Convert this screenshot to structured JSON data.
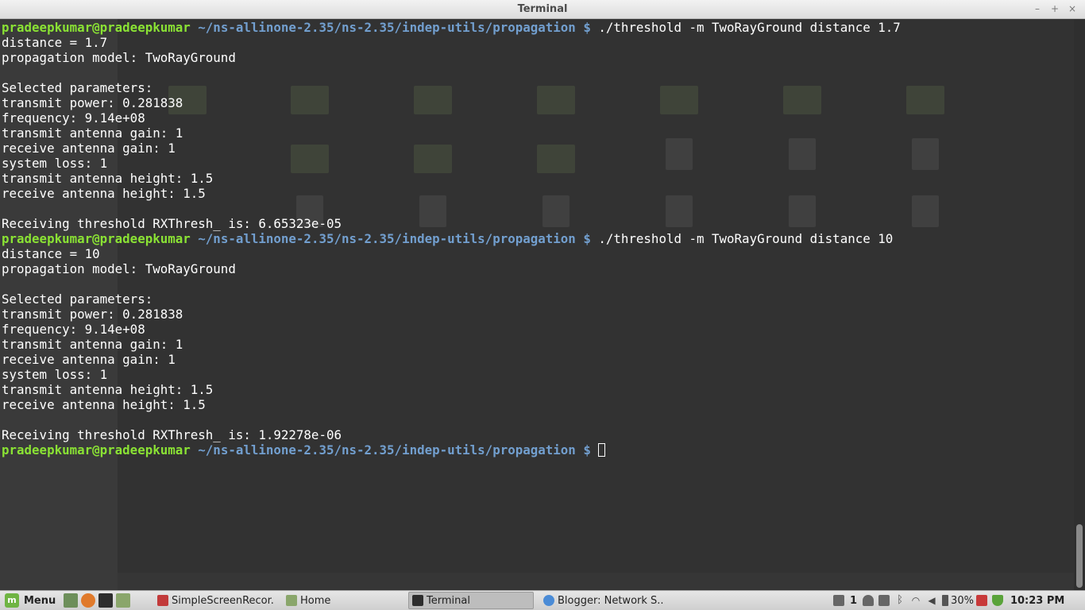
{
  "window": {
    "title": "Terminal",
    "controls": [
      "–",
      "+",
      "×"
    ]
  },
  "terminal": {
    "lines": [
      {
        "type": "prompt",
        "user": "pradeepkumar@pradeepkumar",
        "path": "~/ns-allinone-2.35/ns-2.35/indep-utils/propagation",
        "symbol": "$",
        "command": "./threshold -m TwoRayGround distance 1.7"
      },
      {
        "type": "out",
        "text": "distance = 1.7"
      },
      {
        "type": "out",
        "text": "propagation model: TwoRayGround"
      },
      {
        "type": "out",
        "text": ""
      },
      {
        "type": "out",
        "text": "Selected parameters:"
      },
      {
        "type": "out",
        "text": "transmit power: 0.281838"
      },
      {
        "type": "out",
        "text": "frequency: 9.14e+08"
      },
      {
        "type": "out",
        "text": "transmit antenna gain: 1"
      },
      {
        "type": "out",
        "text": "receive antenna gain: 1"
      },
      {
        "type": "out",
        "text": "system loss: 1"
      },
      {
        "type": "out",
        "text": "transmit antenna height: 1.5"
      },
      {
        "type": "out",
        "text": "receive antenna height: 1.5"
      },
      {
        "type": "out",
        "text": ""
      },
      {
        "type": "out",
        "text": "Receiving threshold RXThresh_ is: 6.65323e-05"
      },
      {
        "type": "prompt",
        "user": "pradeepkumar@pradeepkumar",
        "path": "~/ns-allinone-2.35/ns-2.35/indep-utils/propagation",
        "symbol": "$",
        "command": "./threshold -m TwoRayGround distance 10"
      },
      {
        "type": "out",
        "text": "distance = 10"
      },
      {
        "type": "out",
        "text": "propagation model: TwoRayGround"
      },
      {
        "type": "out",
        "text": ""
      },
      {
        "type": "out",
        "text": "Selected parameters:"
      },
      {
        "type": "out",
        "text": "transmit power: 0.281838"
      },
      {
        "type": "out",
        "text": "frequency: 9.14e+08"
      },
      {
        "type": "out",
        "text": "transmit antenna gain: 1"
      },
      {
        "type": "out",
        "text": "receive antenna gain: 1"
      },
      {
        "type": "out",
        "text": "system loss: 1"
      },
      {
        "type": "out",
        "text": "transmit antenna height: 1.5"
      },
      {
        "type": "out",
        "text": "receive antenna height: 1.5"
      },
      {
        "type": "out",
        "text": ""
      },
      {
        "type": "out",
        "text": "Receiving threshold RXThresh_ is: 1.92278e-06"
      },
      {
        "type": "prompt",
        "user": "pradeepkumar@pradeepkumar",
        "path": "~/ns-allinone-2.35/ns-2.35/indep-utils/propagation",
        "symbol": "$",
        "command": "",
        "cursor": true
      }
    ]
  },
  "taskbar": {
    "menu_label": "Menu",
    "tasks": [
      {
        "label": "SimpleScreenRecor...",
        "icon": "screen-recorder-icon",
        "active": false
      },
      {
        "label": "Home",
        "icon": "folder-icon",
        "active": false
      },
      {
        "label": "Terminal",
        "icon": "terminal-icon",
        "active": true
      },
      {
        "label": "Blogger: Network S...",
        "icon": "chrome-icon",
        "active": false
      }
    ],
    "tray": {
      "notifications": "1",
      "battery": "30%",
      "clock": "10:23 PM"
    }
  },
  "colors": {
    "prompt_user": "#8ae234",
    "prompt_path": "#729fcf",
    "terminal_bg": "#323232",
    "text": "#ffffff"
  }
}
